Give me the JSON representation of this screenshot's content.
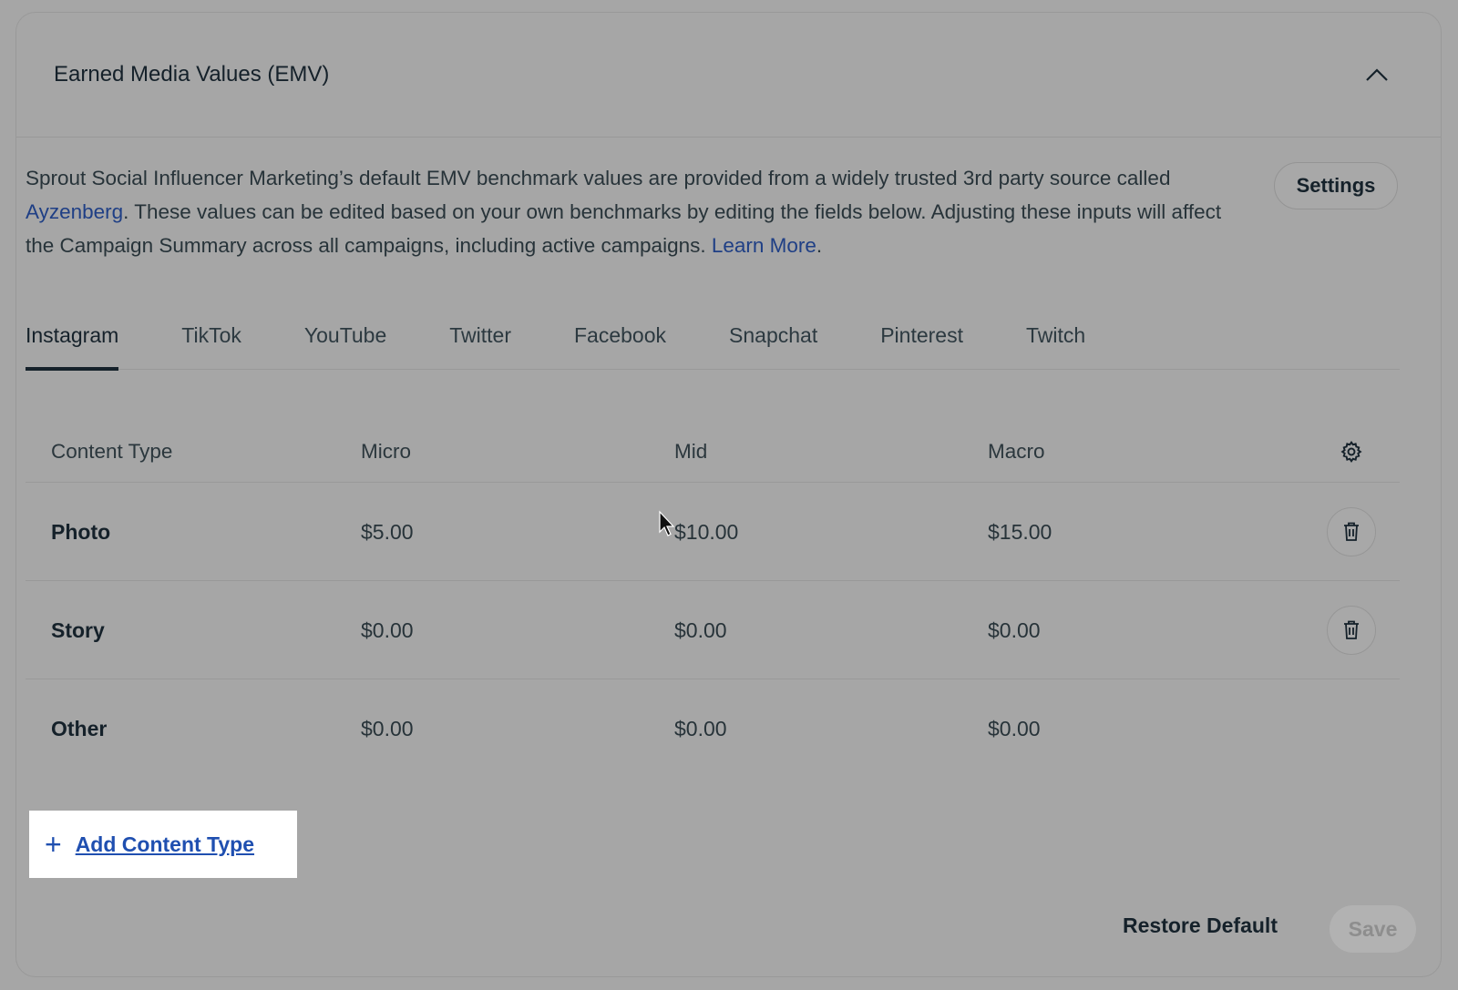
{
  "panel": {
    "title": "Earned Media Values (EMV)"
  },
  "description": {
    "part1": "Sprout Social Influencer Marketing’s default EMV benchmark values are provided from a widely trusted 3rd party source called ",
    "link1": "Ayzenberg",
    "part2": ". These values can be edited based on your own benchmarks by editing the fields below. Adjusting these inputs will affect the Campaign Summary across all campaigns, including active campaigns. ",
    "link2": "Learn More",
    "part3": "."
  },
  "settings_label": "Settings",
  "tabs": [
    {
      "label": "Instagram",
      "active": true
    },
    {
      "label": "TikTok"
    },
    {
      "label": "YouTube"
    },
    {
      "label": "Twitter"
    },
    {
      "label": "Facebook"
    },
    {
      "label": "Snapchat"
    },
    {
      "label": "Pinterest"
    },
    {
      "label": "Twitch"
    }
  ],
  "table": {
    "headers": {
      "type": "Content Type",
      "micro": "Micro",
      "mid": "Mid",
      "macro": "Macro"
    },
    "rows": [
      {
        "type": "Photo",
        "micro": "$5.00",
        "mid": "$10.00",
        "macro": "$15.00"
      },
      {
        "type": "Story",
        "micro": "$0.00",
        "mid": "$0.00",
        "macro": "$0.00"
      },
      {
        "type": "Other",
        "micro": "$0.00",
        "mid": "$0.00",
        "macro": "$0.00"
      }
    ]
  },
  "add_content_type": "Add Content Type",
  "footer": {
    "restore_label": "Restore Default",
    "save_label": "Save"
  },
  "icons": {
    "collapse": "chevron-up-icon",
    "settings": "gear-icon",
    "delete": "trash-icon",
    "add": "plus-icon"
  },
  "colors": {
    "link": "#1f3f85",
    "add_link": "#1f4fb0",
    "text": "#15212a"
  }
}
